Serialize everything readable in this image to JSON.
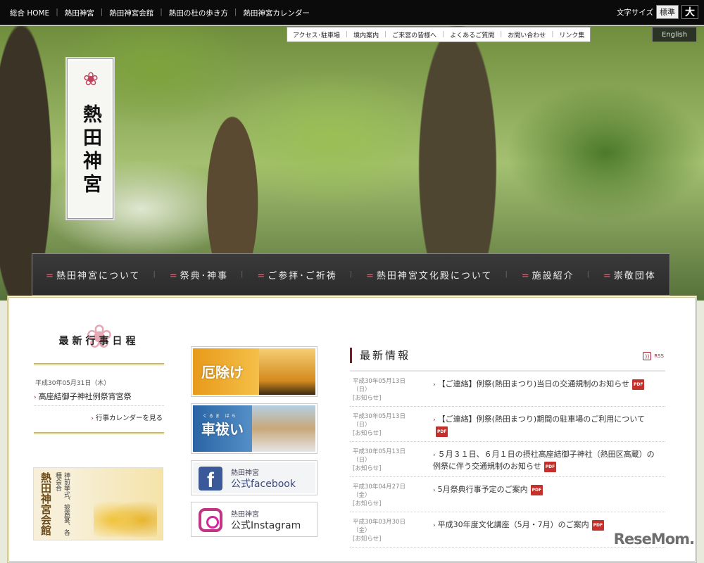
{
  "topbar": {
    "links": [
      "総合 HOME",
      "熱田神宮",
      "熱田神宮会館",
      "熱田の杜の歩き方",
      "熱田神宮カレンダー"
    ],
    "font_size_label": "文字サイズ",
    "font_std": "標準",
    "font_large": "大"
  },
  "subnav": {
    "links": [
      "アクセス･駐車場",
      "境内案内",
      "ご来宮の皆様へ",
      "よくあるご質問",
      "お問い合わせ",
      "リンク集"
    ],
    "english": "English"
  },
  "logo": {
    "name": "熱田神宮"
  },
  "mainnav": {
    "items": [
      "熱田神宮について",
      "祭典･神事",
      "ご参拝･ご祈祷",
      "熱田神宮文化殿について",
      "施設紹介",
      "崇敬団体"
    ]
  },
  "schedule": {
    "title": "最新行事日程",
    "date": "平成30年05月31日（木）",
    "item": "高座結御子神社例祭宵宮祭",
    "calendar_link": "行事カレンダーを見る"
  },
  "kaikan": {
    "name": "熱田神宮会館",
    "desc": "神前挙式、披露宴、各種会合"
  },
  "banners": {
    "yakuyoke": "厄除け",
    "kurumabarai": "車祓い",
    "kurumabarai_ruby": "くるま はら",
    "fb_line1": "熱田神宮",
    "fb_line2": "公式facebook",
    "ig_line1": "熱田神宮",
    "ig_line2": "公式Instagram"
  },
  "news": {
    "title": "最新情報",
    "rss": "RSS",
    "pdf": "PDF",
    "items": [
      {
        "date": "平成30年05月13日",
        "dow": "（日）",
        "cat": "[お知らせ]",
        "title": "【ご連絡】例祭(熱田まつり)当日の交通規制のお知らせ"
      },
      {
        "date": "平成30年05月13日",
        "dow": "（日）",
        "cat": "[お知らせ]",
        "title": "【ご連絡】例祭(熱田まつり)期間の駐車場のご利用について"
      },
      {
        "date": "平成30年05月13日",
        "dow": "（日）",
        "cat": "[お知らせ]",
        "title": "５月３１日、６月１日の摂社高座結御子神社（熱田区高蔵）の例祭に伴う交通規制のお知らせ"
      },
      {
        "date": "平成30年04月27日",
        "dow": "（金）",
        "cat": "[お知らせ]",
        "title": "5月祭典行事予定のご案内"
      },
      {
        "date": "平成30年03月30日",
        "dow": "（金）",
        "cat": "[お知らせ]",
        "title": "平成30年度文化講座（5月・7月）のご案内"
      }
    ]
  },
  "watermark": "ReseMom"
}
